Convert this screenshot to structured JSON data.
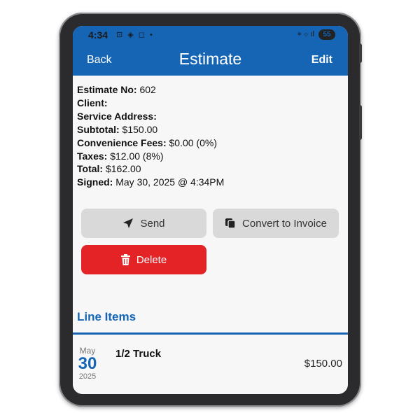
{
  "status_bar": {
    "time": "4:34",
    "left_icons": "⊡ ◈ ◻ •",
    "right_icons": "⌖ ⌔ ıl",
    "battery": "55"
  },
  "header": {
    "back_label": "Back",
    "title": "Estimate",
    "edit_label": "Edit"
  },
  "details": {
    "estimate_no_label": "Estimate No:",
    "estimate_no": "602",
    "client_label": "Client:",
    "client": "",
    "service_address_label": "Service Address:",
    "service_address": "",
    "subtotal_label": "Subtotal:",
    "subtotal": "$150.00",
    "convenience_fees_label": "Convenience Fees:",
    "convenience_fees": "$0.00 (0%)",
    "taxes_label": "Taxes:",
    "taxes": "$12.00 (8%)",
    "total_label": "Total:",
    "total": "$162.00",
    "signed_label": "Signed:",
    "signed": "May 30, 2025 @ 4:34PM"
  },
  "actions": {
    "send_label": "Send",
    "convert_label": "Convert to Invoice",
    "delete_label": "Delete"
  },
  "line_items": {
    "section_title": "Line Items",
    "items": [
      {
        "month": "May",
        "day": "30",
        "year": "2025",
        "name": "1/2 Truck",
        "price": "$150.00"
      }
    ]
  },
  "colors": {
    "brand_blue": "#1565b4",
    "delete_red": "#e32326",
    "button_gray": "#d9d9d9"
  }
}
